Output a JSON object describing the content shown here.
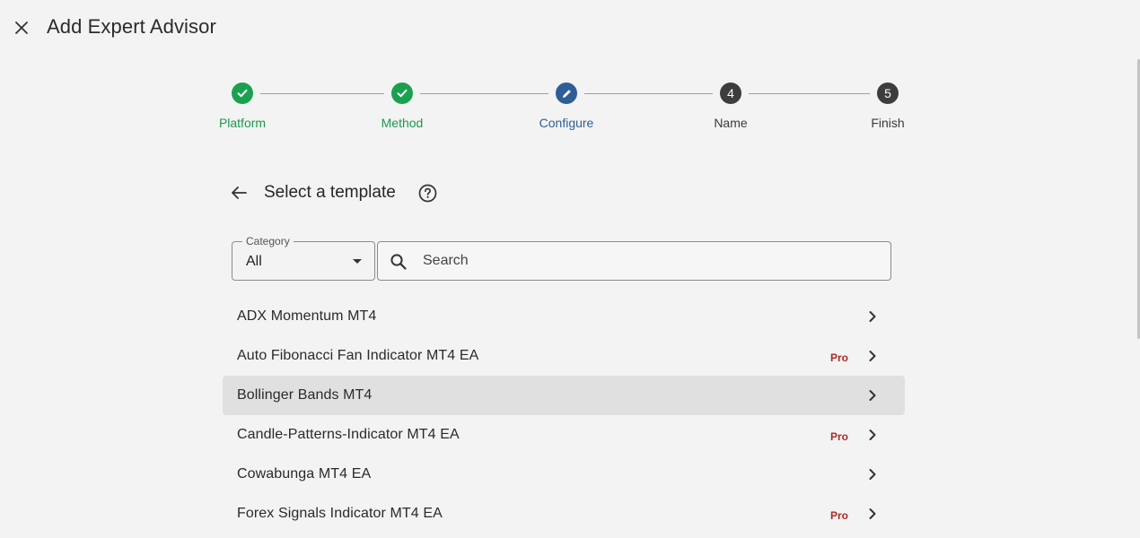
{
  "header": {
    "title": "Add Expert Advisor",
    "close_icon": "close-icon"
  },
  "stepper": {
    "steps": [
      {
        "label": "Platform",
        "state": "done",
        "symbol": ""
      },
      {
        "label": "Method",
        "state": "done",
        "symbol": ""
      },
      {
        "label": "Configure",
        "state": "active",
        "symbol": ""
      },
      {
        "label": "Name",
        "state": "todo",
        "symbol": "4"
      },
      {
        "label": "Finish",
        "state": "todo",
        "symbol": "5"
      }
    ]
  },
  "section": {
    "title": "Select a template",
    "back_icon": "arrow-left-icon",
    "help_icon": "help-circle-icon"
  },
  "filters": {
    "category_label": "Category",
    "category_value": "All",
    "search_placeholder": "Search",
    "search_value": ""
  },
  "templates": [
    {
      "name": "ADX Momentum MT4",
      "badge": ""
    },
    {
      "name": "Auto Fibonacci Fan Indicator MT4 EA",
      "badge": "Pro"
    },
    {
      "name": "Bollinger Bands MT4",
      "badge": ""
    },
    {
      "name": "Candle-Patterns-Indicator MT4 EA",
      "badge": "Pro"
    },
    {
      "name": "Cowabunga MT4 EA",
      "badge": ""
    },
    {
      "name": "Forex Signals Indicator MT4 EA",
      "badge": "Pro"
    }
  ],
  "colors": {
    "done": "#1aa150",
    "active": "#2f5e96",
    "todo": "#3d3d3d",
    "pro": "#b0282a"
  }
}
